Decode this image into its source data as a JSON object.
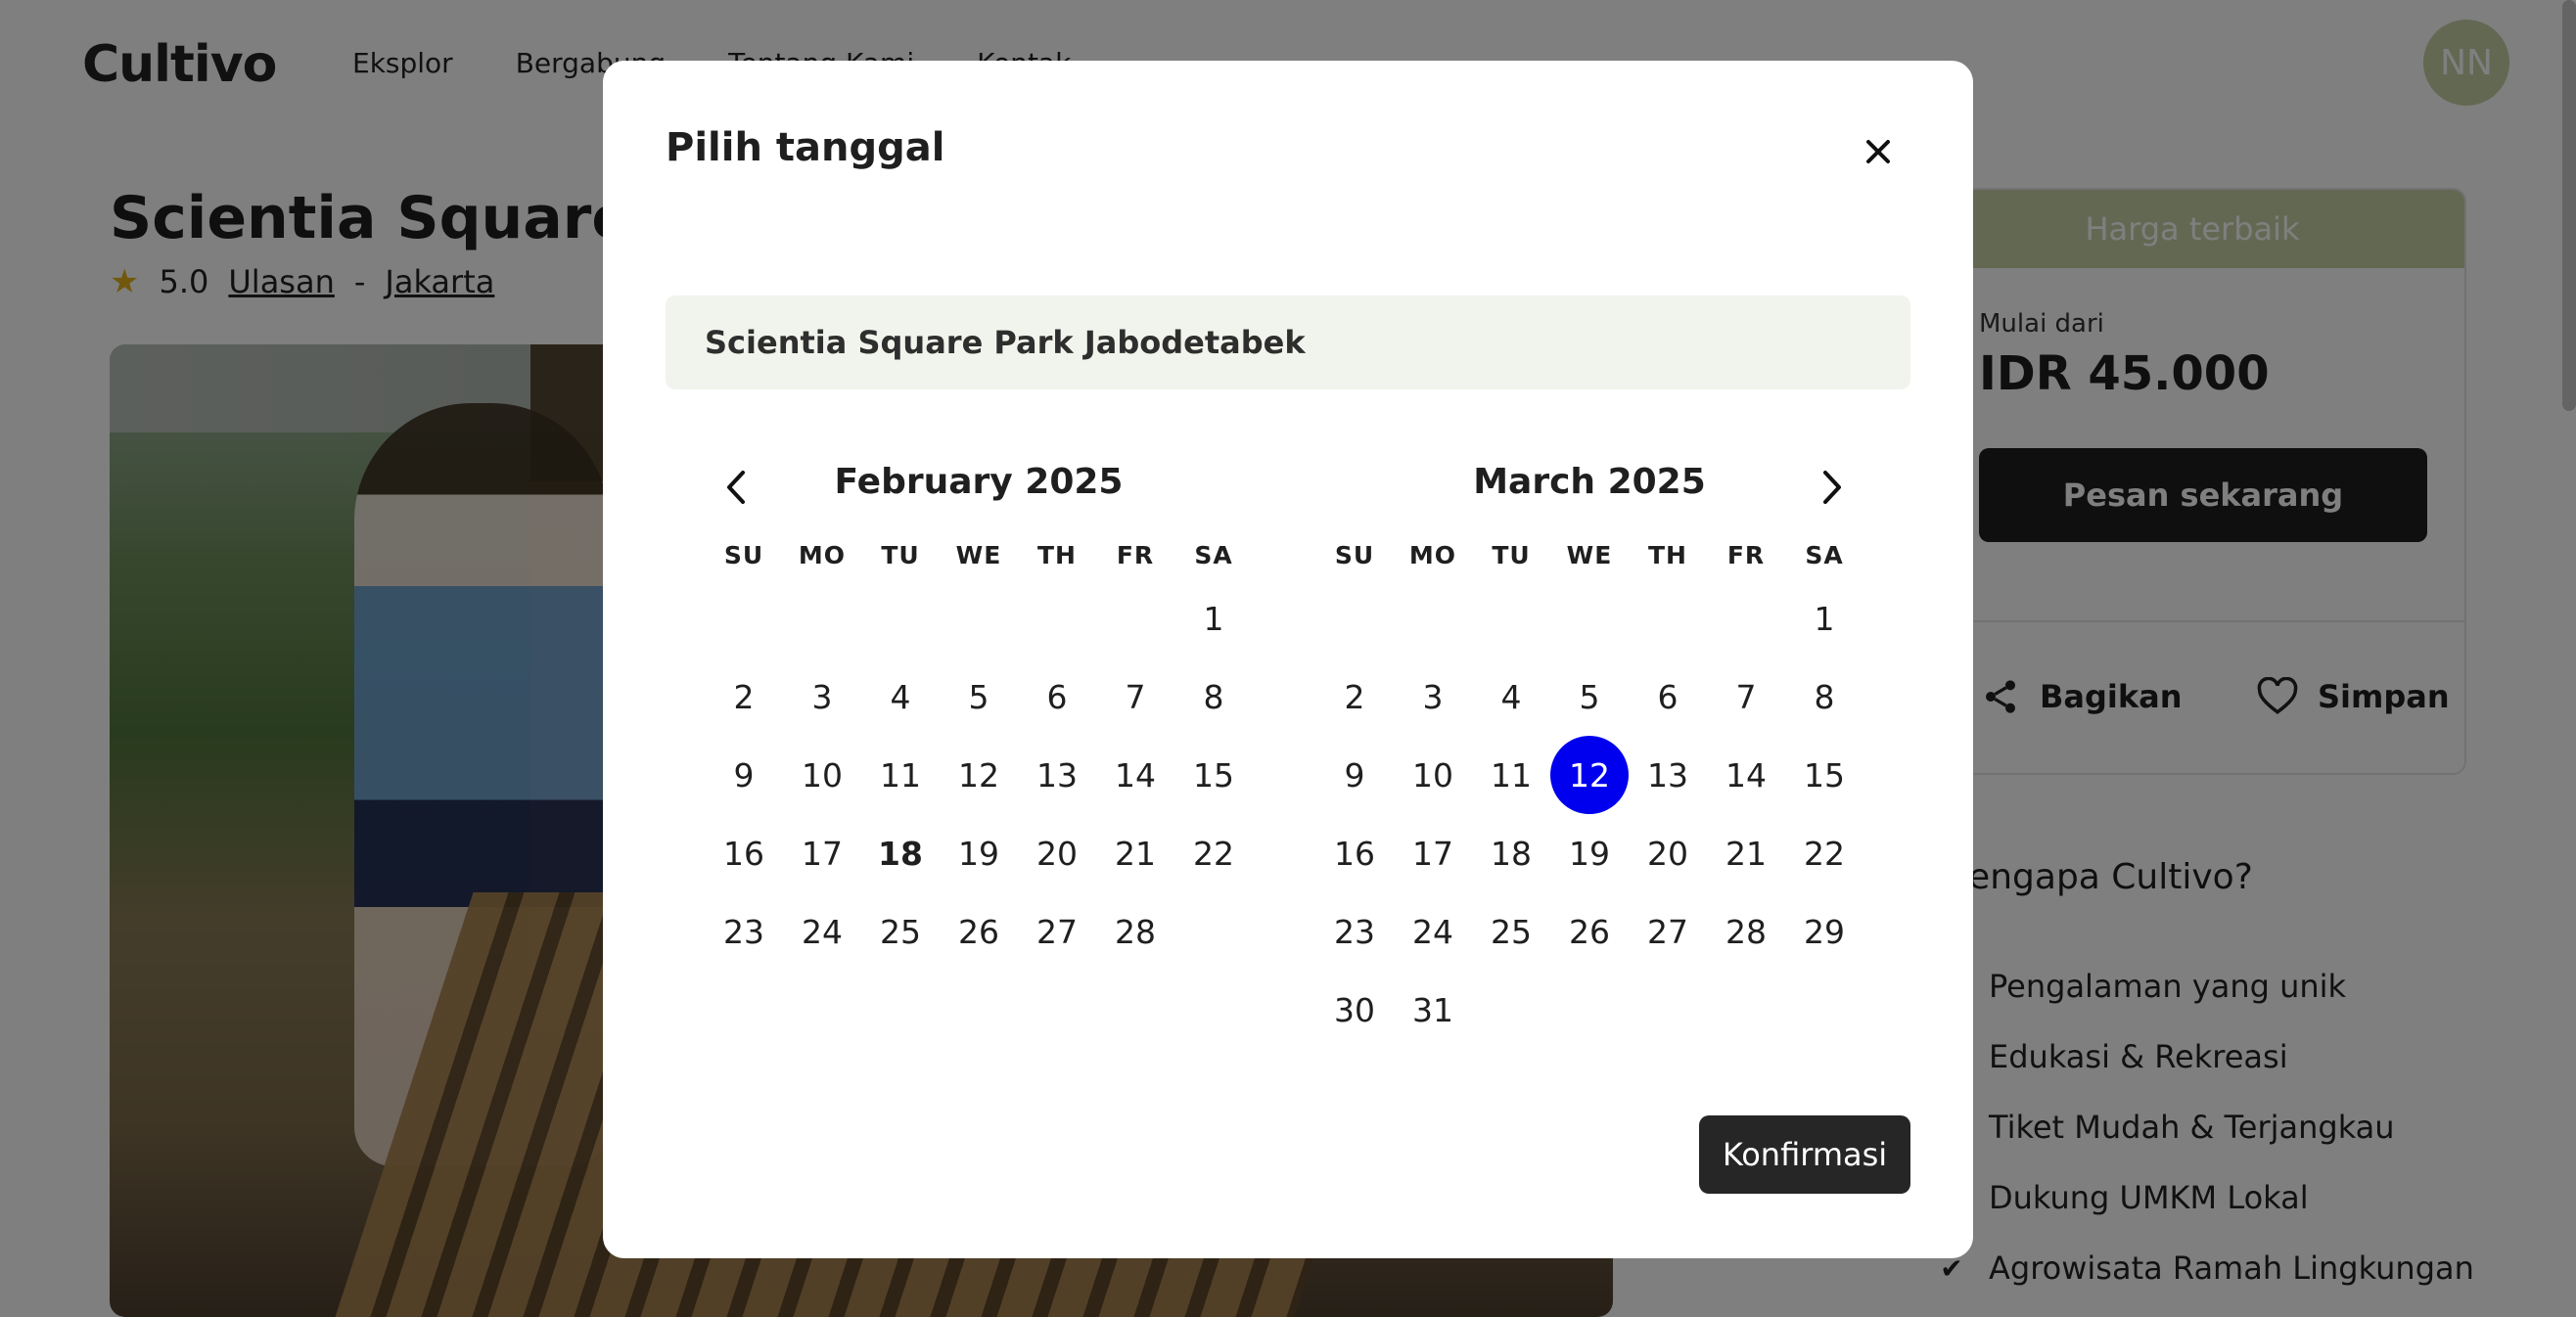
{
  "header": {
    "logo": "Cultivo",
    "nav": [
      "Eksplor",
      "Bergabung",
      "Tentang Kami",
      "Kontak"
    ],
    "avatar_initials": "NN"
  },
  "listing": {
    "title": "Scientia Square Park Jabodetabek",
    "rating": "5.0",
    "reviews_link": "Ulasan",
    "separator": "-",
    "city_link": "Jakarta"
  },
  "booking": {
    "best_price": "Harga terbaik",
    "from_label": "Mulai dari",
    "price": "IDR 45.000",
    "book_button": "Pesan sekarang",
    "share_label": "Bagikan",
    "save_label": "Simpan"
  },
  "why": {
    "title": "Mengapa Cultivo?",
    "items": [
      "Pengalaman yang unik",
      "Edukasi & Rekreasi",
      "Tiket Mudah & Terjangkau",
      "Dukung UMKM Lokal",
      "Agrowisata Ramah Lingkungan"
    ]
  },
  "modal": {
    "title": "Pilih tanggal",
    "place": "Scientia Square Park Jabodetabek",
    "confirm_label": "Konfirmasi",
    "weekdays": [
      "SU",
      "MO",
      "TU",
      "WE",
      "TH",
      "FR",
      "SA"
    ],
    "months": [
      {
        "label": "February 2025",
        "first_weekday": 6,
        "days": 28,
        "today": 18,
        "selected": null
      },
      {
        "label": "March 2025",
        "first_weekday": 6,
        "days": 31,
        "today": null,
        "selected": 12
      }
    ]
  },
  "colors": {
    "accent_green": "#c7d1a6",
    "selected_blue": "#0000ee",
    "dark_button": "#262626",
    "place_bg": "#f1f4ec"
  }
}
